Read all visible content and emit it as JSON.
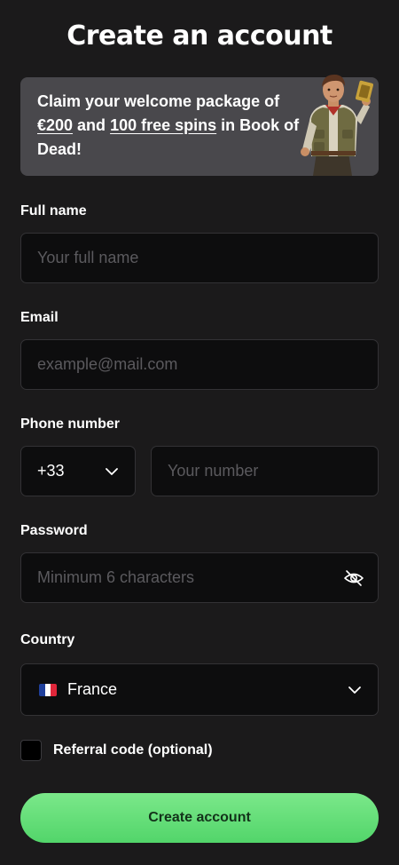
{
  "title": "Create an account",
  "promo": {
    "text_1": "Claim your welcome package of ",
    "amount": "€200",
    "text_2": " and ",
    "spins": "100 free spins",
    "text_3": " in Book of Dead!"
  },
  "form": {
    "full_name": {
      "label": "Full name",
      "placeholder": "Your full name",
      "value": ""
    },
    "email": {
      "label": "Email",
      "placeholder": "example@mail.com",
      "value": ""
    },
    "phone": {
      "label": "Phone number",
      "code": "+33",
      "placeholder": "Your number",
      "value": ""
    },
    "password": {
      "label": "Password",
      "placeholder": "Minimum 6 characters",
      "value": ""
    },
    "country": {
      "label": "Country",
      "value": "France",
      "flag_colors": [
        "#1f3f9b",
        "#ffffff",
        "#e0263a"
      ]
    },
    "referral": {
      "label": "Referral code (optional)",
      "checked": false
    },
    "submit_label": "Create account"
  },
  "colors": {
    "background": "#1b1a1b",
    "promo_background": "#49484c",
    "field_background": "#0d0d0e",
    "accent_green": "#5cdb70"
  },
  "icons": {
    "phone_code_chevron": "chevron-down-icon",
    "password_toggle": "eye-off-icon",
    "country_chevron": "chevron-down-icon"
  }
}
